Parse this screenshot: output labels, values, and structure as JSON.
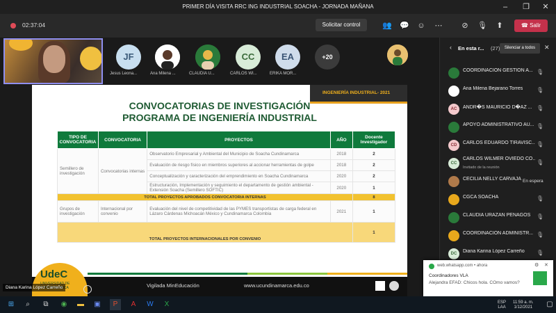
{
  "window": {
    "title": "PRIMER DÍA VISITA RRC ING INDUSTRIAL SOACHA - JORNADA MAÑANA"
  },
  "toolbar": {
    "timer": "02:37:04",
    "request_control": "Solicitar control",
    "leave": "Salir",
    "icons": [
      "people-icon",
      "chat-icon",
      "reactions-icon",
      "more-icon",
      "camera-off-icon",
      "mic-off-icon",
      "share-icon",
      "phone-icon"
    ]
  },
  "participants_strip": [
    {
      "initials": "JF",
      "name": "Jesus Leona...",
      "color": "#c8dff0",
      "text_color": "#3a5a78"
    },
    {
      "initials": "",
      "name": "Ana Milena ...",
      "color": "#ffffff",
      "photo": true
    },
    {
      "initials": "",
      "name": "CLAUDIA U...",
      "color": "#2a7a3a",
      "photo": true
    },
    {
      "initials": "CC",
      "name": "CARLOS WI...",
      "color": "#d8ecd8",
      "text_color": "#3b6b3b"
    },
    {
      "initials": "EA",
      "name": "ERIKA MOR...",
      "color": "#cfdceb",
      "text_color": "#3b5575"
    },
    {
      "initials": "+20",
      "name": "",
      "color": "#3b3b3b",
      "text_color": "#ffffff"
    }
  ],
  "slide": {
    "header": "INGENIERÍA INDUSTRIAL- 2021",
    "title_line1": "CONVOCATORIAS DE INVESTIGACIÓN",
    "title_line2": "PROGRAMA DE INGENIERÍA INDUSTRIAL",
    "columns": [
      "TIPO DE CONVOCATORIA",
      "CONVOCATORIA",
      "PROYECTOS",
      "AÑO",
      "Docente Investigador"
    ],
    "group1": {
      "tipo": "Semillero de investigación",
      "convocatoria": "Convocatorias internas",
      "rows": [
        {
          "proyecto": "Observatorio Empresarial y Ambiental del Municipio de Soacha Cundinamarca",
          "anio": "2018",
          "docente": "2"
        },
        {
          "proyecto": "Evaluación de riesgo físico en miembros superiores al accionar herramientas de golpe",
          "anio": "2018",
          "docente": "2"
        },
        {
          "proyecto": "Conceptualización y caracterización del emprendimiento en Soacha Cundinamarca",
          "anio": "2020",
          "docente": "2"
        },
        {
          "proyecto": "Estructuración, Implementación y seguimiento el departamento de gestión ambiental - Extensión Soacha (Semillero SOFTIC)",
          "anio": "2020",
          "docente": "1"
        }
      ],
      "total_label": "TOTAL PROYECTOS APROBADOS CONVOCATORIA INTERNAS",
      "total_value": "8"
    },
    "group2": {
      "tipo": "Grupos de investigación",
      "convocatoria": "Internacional por convenio",
      "rows": [
        {
          "proyecto": "Evaluación del nivel de competitividad de las PYMES transportistas de carga federal en Lázaro Cárdenas Michoacán México y Cundinamarca Colombia",
          "anio": "2021",
          "docente": "1"
        }
      ],
      "total_value": "1",
      "total_label": "TOTAL PROYECTOS INTERNACIONALES POR CONVENIO"
    },
    "footer_vigilada": "Vigilada MinEducación",
    "footer_url": "www.ucundinamarca.edu.co",
    "logo_text": "UdeC",
    "logo_sub": "UNIVERSIDAD DE CUNDINAMARCA"
  },
  "presenter_name": "Diana Karina López Carreño",
  "panel": {
    "label": "En esta r...",
    "count": "(27)",
    "silence_all": "Silenciar a todos",
    "people": [
      {
        "initials": "",
        "name": "COORDINACIÓN GESTIÓN A...",
        "color": "#2a7a3a",
        "photo": true
      },
      {
        "initials": "",
        "name": "Ana Milena Bejarano Torres",
        "color": "#ffffff",
        "photo": true
      },
      {
        "initials": "AC",
        "name": "ANDR�S MAURICIO D�AZ ...",
        "color": "#f3c9cc",
        "text_color": "#8a2d35"
      },
      {
        "initials": "",
        "name": "APOYO ADMINISTRATIVO AU...",
        "color": "#2a7a3a",
        "photo": true
      },
      {
        "initials": "CD",
        "name": "CARLOS EDUARDO TIRAVISC...",
        "color": "#f3c9cc",
        "text_color": "#8a2d35"
      },
      {
        "initials": "CC",
        "name": "CARLOS WILMER OVIEDO CO...",
        "sub": "Invitado de la reunión",
        "color": "#d8ecd8",
        "text_color": "#3b6b3b"
      },
      {
        "initials": "",
        "name": "CECILIA NELLY CARVAJAL ...",
        "state": "En espera",
        "color": "#b07a4a",
        "photo": true
      },
      {
        "initials": "",
        "name": "CGCA SOACHA",
        "color": "#e8a81c",
        "photo": true
      },
      {
        "initials": "",
        "name": "CLAUDIA URAZAN PENAGOS",
        "color": "#2a7a3a",
        "photo": true
      },
      {
        "initials": "",
        "name": "COORDINACIÓN ADMINISTR...",
        "color": "#e8a81c",
        "photo": true
      },
      {
        "initials": "DC",
        "name": "Diana Karina López Carreño",
        "color": "#d8ecd8",
        "text_color": "#3b6b3b"
      }
    ]
  },
  "toast": {
    "source": "web.whatsapp.com",
    "time": "ahora",
    "title": "Coordinadores VLA",
    "message": "Alejandra EFAD: Chicos hola. COmo vamos?"
  },
  "taskbar": {
    "lang": "ESP",
    "lang2": "LAA",
    "time": "11:59 a. m.",
    "date": "1/12/2021"
  }
}
